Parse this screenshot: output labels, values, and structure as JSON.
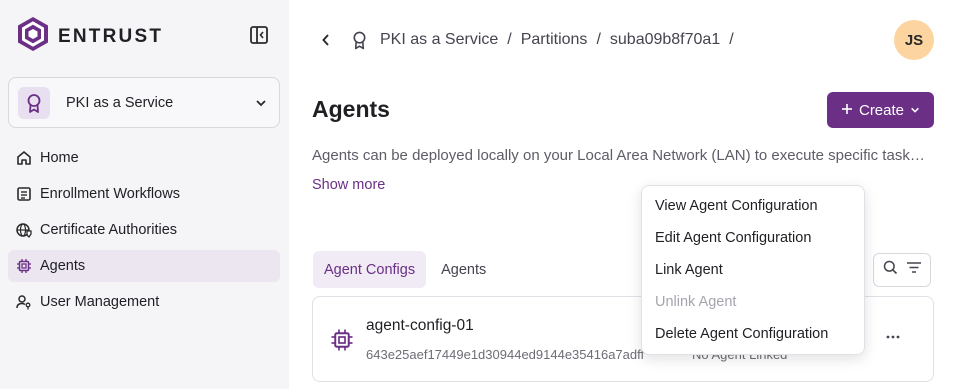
{
  "app": {
    "brand": "ENTRUST",
    "logo_icon": "entrust-logo-icon",
    "accent_color": "#6b2f85"
  },
  "sidebar": {
    "service_selector": {
      "label": "PKI as a Service",
      "icon": "badge-icon"
    },
    "items": [
      {
        "label": "Home",
        "icon": "home-icon",
        "active": false
      },
      {
        "label": "Enrollment Workflows",
        "icon": "form-icon",
        "active": false
      },
      {
        "label": "Certificate Authorities",
        "icon": "globe-shield-icon",
        "active": false
      },
      {
        "label": "Agents",
        "icon": "chip-icon",
        "active": true
      },
      {
        "label": "User Management",
        "icon": "user-key-icon",
        "active": false
      }
    ]
  },
  "header": {
    "breadcrumb": [
      "PKI as a Service",
      "Partitions",
      "suba09b8f70a1"
    ],
    "avatar_initials": "JS"
  },
  "page": {
    "title": "Agents",
    "create_label": "Create",
    "description": "Agents can be deployed locally on your Local Area Network (LAN) to execute specific tasks on behalf of PKI as a Service.",
    "show_more": "Show more"
  },
  "tabs": [
    {
      "label": "Agent Configs",
      "active": true
    },
    {
      "label": "Agents",
      "active": false
    }
  ],
  "agent_configs": [
    {
      "name": "agent-config-01",
      "id": "643e25aef17449e1d30944ed9144e35416a7adff",
      "status": "No Agent Linked"
    }
  ],
  "context_menu": {
    "items": [
      {
        "label": "View Agent Configuration",
        "disabled": false
      },
      {
        "label": "Edit Agent Configuration",
        "disabled": false
      },
      {
        "label": "Link Agent",
        "disabled": false
      },
      {
        "label": "Unlink Agent",
        "disabled": true
      },
      {
        "label": "Delete Agent Configuration",
        "disabled": false
      }
    ]
  }
}
